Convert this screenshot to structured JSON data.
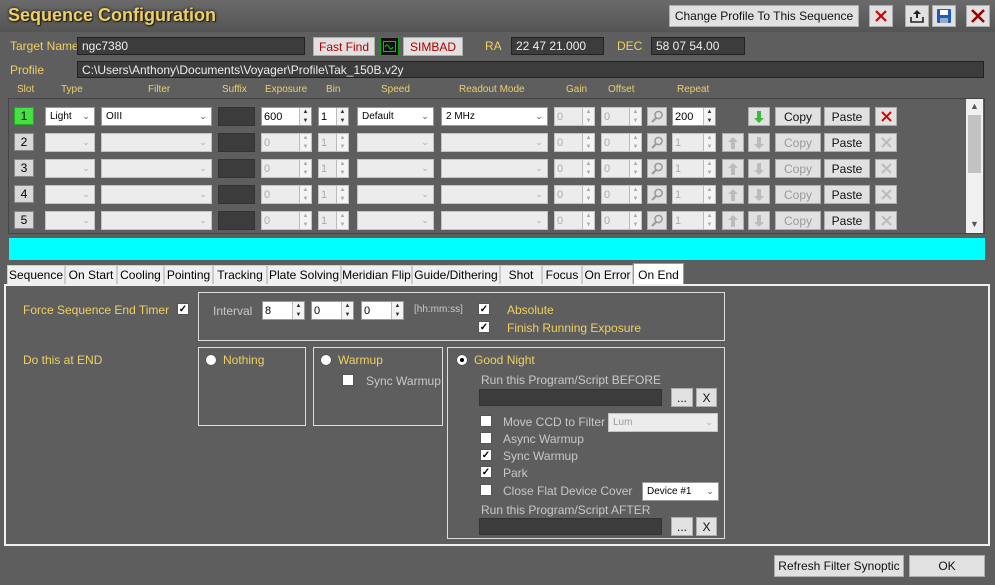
{
  "window": {
    "title": "Sequence Configuration",
    "change_profile_label": "Change Profile To This Sequence"
  },
  "target": {
    "label": "Target Name",
    "value": "ngc7380",
    "fast_find": "Fast Find",
    "simbad": "SIMBAD",
    "ra_label": "RA",
    "ra_value": "22 47 21.000",
    "dec_label": "DEC",
    "dec_value": "58 07 54.00"
  },
  "profile": {
    "label": "Profile",
    "value": "C:\\Users\\Anthony\\Documents\\Voyager\\Profile\\Tak_150B.v2y"
  },
  "columns": [
    "Slot",
    "Type",
    "Filter",
    "Suffix",
    "Exposure",
    "Bin",
    "Speed",
    "Readout Mode",
    "Gain",
    "Offset",
    "Repeat"
  ],
  "rows": [
    {
      "slot": "1",
      "type": "Light",
      "filter": "OIII",
      "exposure": "600",
      "bin": "1",
      "speed": "Default",
      "readout": "2 MHz",
      "gain": "0",
      "offset": "0",
      "repeat": "200",
      "copy": "Copy",
      "paste": "Paste"
    },
    {
      "slot": "2",
      "type": "",
      "filter": "",
      "exposure": "0",
      "bin": "1",
      "speed": "",
      "readout": "",
      "gain": "0",
      "offset": "0",
      "repeat": "1",
      "copy": "Copy",
      "paste": "Paste"
    },
    {
      "slot": "3",
      "type": "",
      "filter": "",
      "exposure": "0",
      "bin": "1",
      "speed": "",
      "readout": "",
      "gain": "0",
      "offset": "0",
      "repeat": "1",
      "copy": "Copy",
      "paste": "Paste"
    },
    {
      "slot": "4",
      "type": "",
      "filter": "",
      "exposure": "0",
      "bin": "1",
      "speed": "",
      "readout": "",
      "gain": "0",
      "offset": "0",
      "repeat": "1",
      "copy": "Copy",
      "paste": "Paste"
    },
    {
      "slot": "5",
      "type": "",
      "filter": "",
      "exposure": "0",
      "bin": "1",
      "speed": "",
      "readout": "",
      "gain": "0",
      "offset": "0",
      "repeat": "1",
      "copy": "Copy",
      "paste": "Paste"
    }
  ],
  "tabs": [
    "Sequence",
    "On Start",
    "Cooling",
    "Pointing",
    "Tracking",
    "Plate Solving",
    "Meridian Flip",
    "Guide/Dithering",
    "Shot",
    "Focus",
    "On Error",
    "On End"
  ],
  "on_end": {
    "force_timer_label": "Force Sequence End Timer",
    "interval_label": "Interval",
    "hh": "8",
    "mm": "0",
    "ss": "0",
    "format_hint": "[hh:mm:ss]",
    "absolute": "Absolute",
    "finish_running": "Finish Running Exposure",
    "do_at_end": "Do this at END",
    "nothing": "Nothing",
    "warmup": "Warmup",
    "sync_warmup": "Sync Warmup",
    "good_night": "Good Night",
    "run_before": "Run this Program/Script BEFORE",
    "browse": "...",
    "clear": "X",
    "move_ccd": "Move CCD to Filter",
    "move_ccd_value": "Lum",
    "async_warmup": "Async Warmup",
    "sync_warmup2": "Sync Warmup",
    "park": "Park",
    "close_flat": "Close Flat Device Cover",
    "device_value": "Device #1",
    "run_after": "Run this Program/Script AFTER"
  },
  "footer": {
    "refresh": "Refresh Filter Synoptic",
    "ok": "OK"
  }
}
